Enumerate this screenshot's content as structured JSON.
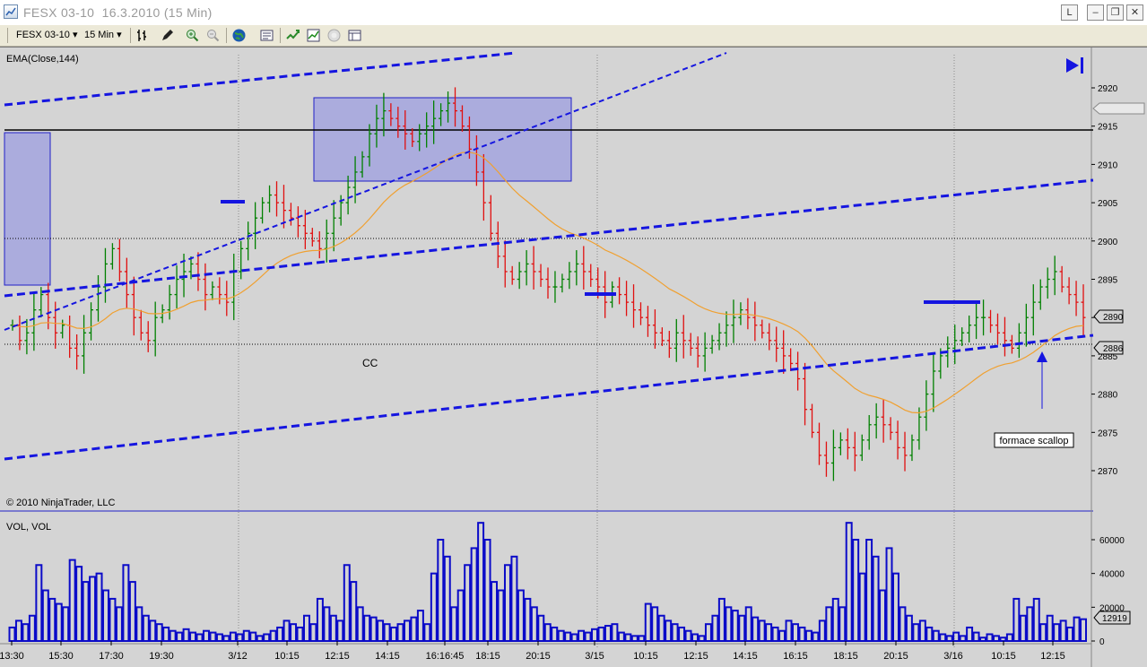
{
  "window": {
    "title": "FESX 03-10  16.3.2010 (15 Min)",
    "buttons": {
      "link": "L",
      "minimize": "–",
      "maximize": "❐",
      "close": "✕"
    }
  },
  "toolbar": {
    "instrument": "FESX 03-10",
    "interval": "15 Min",
    "icons": [
      "bar-style-icon",
      "drawing-pencil-icon",
      "zoom-in-icon",
      "zoom-out-icon",
      "globe-icon",
      "properties-icon",
      "strategy-icon",
      "chart-style-icon",
      "disabled-icon",
      "data-box-icon"
    ]
  },
  "chart": {
    "indicator_label": "EMA(Close,144)",
    "copyright": "© 2010 NinjaTrader, LLC",
    "volume_label": "VOL, VOL",
    "annotation_cc": "CC",
    "annotation_box": "formace scallop",
    "colors": {
      "background": "#d4d4d4",
      "trendline": "#1515e0",
      "ema": "#f0a030",
      "up_bar": "#008000",
      "down_bar": "#e01010",
      "volume": "#0b0bc8"
    }
  },
  "chart_data": [
    {
      "type": "candlestick",
      "ylim": [
        2866,
        2924
      ],
      "y_ticks": [
        2920,
        2915,
        2910,
        2905,
        2900,
        2895,
        2890,
        2885,
        2880,
        2875,
        2870
      ],
      "price_markers": [
        2890,
        2886
      ],
      "x_tick_labels": [
        "13:30",
        "15:30",
        "17:30",
        "19:30",
        "3/12",
        "10:15",
        "12:15",
        "14:15",
        "16:16:45",
        "18:15",
        "20:15",
        "3/15",
        "10:15",
        "12:15",
        "14:15",
        "16:15",
        "18:15",
        "20:15",
        "3/16",
        "10:15",
        "12:15"
      ],
      "ohlc": [
        2889,
        2887,
        2888,
        2891,
        2893,
        2890,
        2888,
        2889,
        2886,
        2885,
        2888,
        2891,
        2894,
        2897,
        2899,
        2896,
        2893,
        2890,
        2888,
        2887,
        2890,
        2891,
        2893,
        2895,
        2896,
        2897,
        2895,
        2893,
        2894,
        2893,
        2892,
        2896,
        2899,
        2901,
        2903,
        2905,
        2906,
        2905,
        2904,
        2903,
        2902,
        2901,
        2900,
        2899,
        2901,
        2903,
        2905,
        2907,
        2909,
        2911,
        2914,
        2916,
        2917,
        2916,
        2915,
        2914,
        2913,
        2914,
        2915,
        2916,
        2917,
        2918,
        2917,
        2915,
        2912,
        2909,
        2905,
        2901,
        2898,
        2896,
        2895,
        2896,
        2897,
        2896,
        2895,
        2894,
        2894,
        2895,
        2896,
        2897,
        2896,
        2895,
        2894,
        2892,
        2894,
        2893,
        2892,
        2891,
        2890,
        2889,
        2888,
        2887,
        2886,
        2888,
        2887,
        2886,
        2885,
        2886,
        2887,
        2888,
        2889,
        2890,
        2891,
        2890,
        2889,
        2888,
        2887,
        2886,
        2885,
        2884,
        2882,
        2878,
        2875,
        2872,
        2871,
        2873,
        2874,
        2873,
        2872,
        2874,
        2876,
        2877,
        2876,
        2875,
        2873,
        2872,
        2874,
        2877,
        2880,
        2883,
        2885,
        2886,
        2887,
        2888,
        2889,
        2890,
        2890,
        2889,
        2888,
        2887,
        2886,
        2888,
        2890,
        2892,
        2894,
        2895,
        2896,
        2894,
        2893,
        2892,
        2890
      ],
      "ema_label_value": 2890,
      "last_price": 2886
    },
    {
      "type": "bar",
      "title": "VOL, VOL",
      "ylim": [
        0,
        70000
      ],
      "y_ticks": [
        60000,
        40000,
        20000,
        0
      ],
      "last_value_label": "12919",
      "values": [
        8000,
        12000,
        10000,
        15000,
        45000,
        30000,
        25000,
        22000,
        20000,
        48000,
        44000,
        35000,
        38000,
        40000,
        30000,
        25000,
        20000,
        45000,
        35000,
        20000,
        15000,
        12000,
        10000,
        8000,
        6000,
        5000,
        7000,
        5000,
        4000,
        6000,
        5000,
        4000,
        3000,
        5000,
        4000,
        6000,
        5000,
        3000,
        4000,
        6000,
        8000,
        12000,
        10000,
        8000,
        15000,
        10000,
        25000,
        20000,
        15000,
        12000,
        45000,
        35000,
        20000,
        15000,
        14000,
        12000,
        10000,
        8000,
        10000,
        12000,
        14000,
        18000,
        10000,
        40000,
        60000,
        50000,
        20000,
        30000,
        45000,
        55000,
        70000,
        60000,
        35000,
        30000,
        45000,
        50000,
        30000,
        25000,
        20000,
        15000,
        10000,
        8000,
        6000,
        5000,
        4000,
        6000,
        5000,
        7000,
        8000,
        9000,
        10000,
        5000,
        4000,
        3000,
        3000,
        22000,
        20000,
        15000,
        12000,
        10000,
        8000,
        6000,
        4000,
        3000,
        10000,
        15000,
        25000,
        20000,
        18000,
        15000,
        20000,
        14000,
        12000,
        10000,
        8000,
        6000,
        12000,
        10000,
        8000,
        6000,
        5000,
        12000,
        20000,
        25000,
        20000,
        70000,
        60000,
        40000,
        60000,
        50000,
        30000,
        55000,
        40000,
        20000,
        15000,
        10000,
        12000,
        8000,
        6000,
        4000,
        3000,
        5000,
        3000,
        8000,
        5000,
        2000,
        4000,
        3000,
        2000,
        4000,
        25000,
        15000,
        20000,
        25000,
        10000,
        15000,
        10000,
        12000,
        8000,
        14000,
        12919
      ]
    }
  ]
}
